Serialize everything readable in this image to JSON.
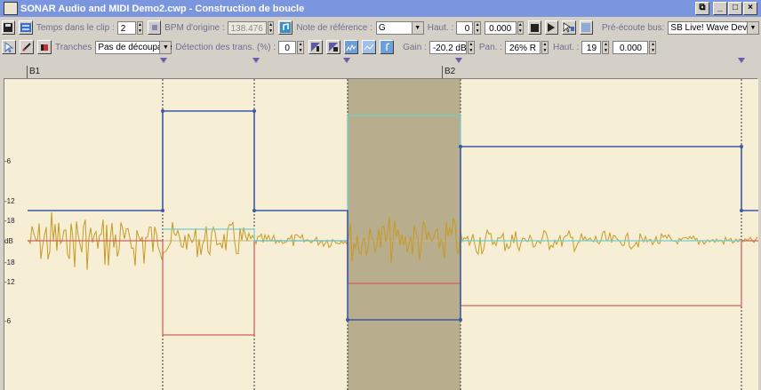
{
  "window": {
    "title": "SONAR Audio and MIDI Demo2.cwp - Construction de boucle",
    "controls": [
      "restore",
      "minimize",
      "maximize",
      "close"
    ]
  },
  "toolbar1": {
    "beats_label": "Temps dans le clip :",
    "beats_value": "2",
    "orig_bpm_label": "BPM d'origine :",
    "orig_bpm_value": "138.476",
    "ref_note_label": "Note de référence :",
    "ref_note_value": "G",
    "pitch_label": "Haut. :",
    "pitch_value": "0",
    "pitch_fine_value": "0.000",
    "preview_bus_label": "Pré-écoute bus:",
    "preview_bus_value": "SB Live! Wave Device"
  },
  "toolbar2": {
    "slices_label": "Tranches",
    "slices_value": "Pas de découpage",
    "transient_label": "Détection des trans. (%) :",
    "transient_value": "0",
    "gain_label": "Gain :",
    "gain_value": "-20.2 dB",
    "pan_label": "Pan. :",
    "pan_value": "26% R",
    "pitch2_label": "Haut. :",
    "pitch2_value": "19",
    "pitch2_fine_value": "0.000"
  },
  "ruler": {
    "bar1_label": "B1",
    "bar2_label": "B2"
  },
  "db_scale": [
    "-6",
    "-12",
    "-18",
    "dB",
    "-18",
    "-12",
    "-6"
  ],
  "colors": {
    "background": "#f7eed6",
    "waveform": "#c79a22",
    "volume_envelope": "#3a5aa8",
    "pan_envelope": "#d06060",
    "pitch_envelope": "#6fcfcf",
    "selection": "#b8ad8c",
    "slice_marker": "#6d5ab0"
  },
  "icons": {
    "save": "floppy-icon",
    "loop": "loop-icon",
    "tempo": "metronome-icon",
    "refnote": "note-icon",
    "stop": "stop-icon",
    "play": "play-icon",
    "select": "select-arrow-icon",
    "draw": "pencil-icon",
    "erase": "eraser-icon"
  }
}
